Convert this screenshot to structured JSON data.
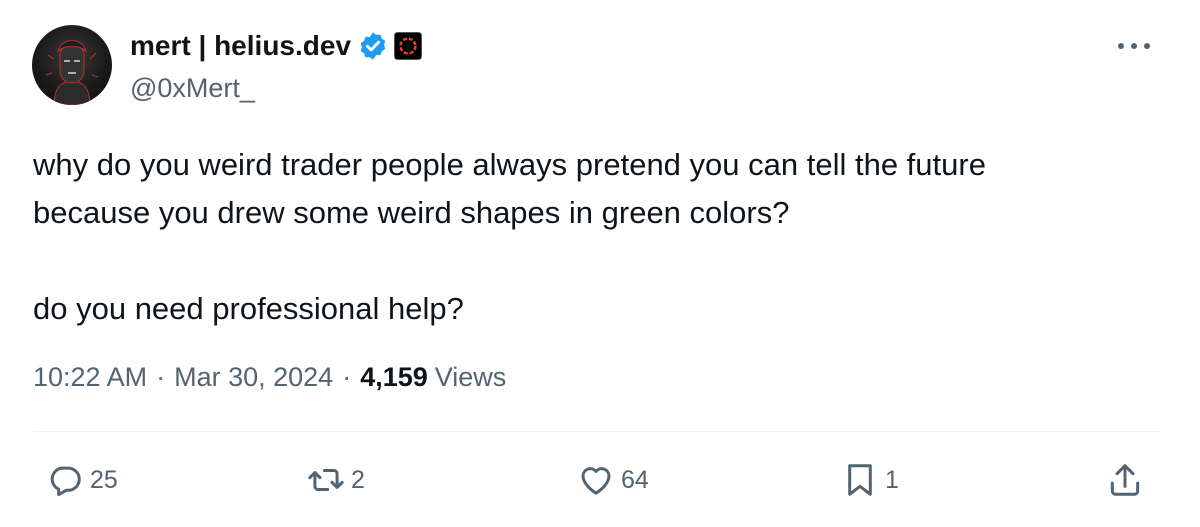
{
  "author": {
    "display_name": "mert | helius.dev",
    "handle": "@0xMert_"
  },
  "tweet": {
    "lines": [
      "why do you weird trader people always pretend you can tell the future",
      "because you drew some weird shapes in green colors?",
      "do you need professional help?"
    ],
    "time": "10:22 AM",
    "separator": "·",
    "date": "Mar 30, 2024",
    "views_count": "4,159",
    "views_label": "Views"
  },
  "actions": {
    "replies": "25",
    "reposts": "2",
    "likes": "64",
    "bookmarks": "1"
  },
  "icons": {
    "more": "more-horizontal-icon",
    "verified": "verified-badge-icon",
    "affiliate": "affiliate-badge-icon",
    "reply": "reply-icon",
    "repost": "repost-icon",
    "like": "heart-icon",
    "bookmark": "bookmark-icon",
    "share": "share-icon"
  },
  "colors": {
    "text": "#0f1419",
    "secondary": "#536471",
    "verified": "#1d9bf0",
    "divider": "#eff3f4"
  }
}
